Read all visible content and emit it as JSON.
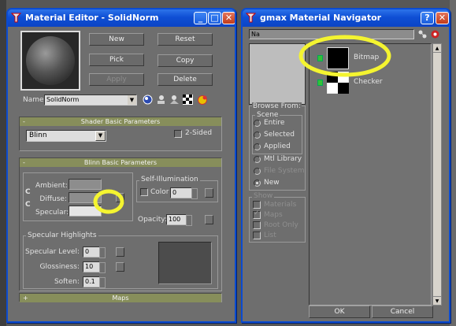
{
  "material_editor": {
    "title": "Material Editor - SolidNorm",
    "buttons": {
      "new": "New",
      "reset": "Reset",
      "pick": "Pick",
      "copy": "Copy",
      "apply": "Apply",
      "delete": "Delete"
    },
    "name_label": "Name",
    "name_value": "SolidNorm",
    "shader_rollout": {
      "title": "Shader Basic Parameters",
      "shader_value": "Blinn",
      "two_sided_label": "2-Sided"
    },
    "blinn_rollout": {
      "title": "Blinn Basic Parameters",
      "ambient_label": "Ambient:",
      "diffuse_label": "Diffuse:",
      "specular_label": "Specular:",
      "lock_c1": "C",
      "lock_c2": "C",
      "self_illum_title": "Self-Illumination",
      "color_label": "Color",
      "color_value": "0",
      "opacity_label": "Opacity:",
      "opacity_value": "100",
      "specular_group_title": "Specular Highlights",
      "spec_level_label": "Specular Level:",
      "spec_level_value": "0",
      "glossiness_label": "Glossiness:",
      "glossiness_value": "10",
      "soften_label": "Soften:",
      "soften_value": "0.1"
    },
    "maps_rollout": {
      "title": "Maps",
      "toggle": "+"
    },
    "collapse_symbol": "-"
  },
  "navigator": {
    "title": "gmax Material Navigator",
    "name_label": "Na",
    "items": [
      {
        "label": "Bitmap"
      },
      {
        "label": "Checker"
      }
    ],
    "browse_from_label": "Browse From:",
    "scene_group_label": "Scene",
    "scene_options": [
      {
        "label": "Entire",
        "enabled": true
      },
      {
        "label": "Selected",
        "enabled": true
      },
      {
        "label": "Applied",
        "enabled": true
      }
    ],
    "other_options": [
      {
        "label": "Mtl Library",
        "enabled": true
      },
      {
        "label": "File System",
        "enabled": false
      },
      {
        "label": "New",
        "enabled": true,
        "selected": true
      }
    ],
    "show_label": "Show",
    "show_options": [
      {
        "label": "Materials",
        "checked": false
      },
      {
        "label": "Maps",
        "checked": true
      },
      {
        "label": "Root Only",
        "checked": false
      },
      {
        "label": "List",
        "checked": false
      }
    ],
    "ok_label": "OK",
    "cancel_label": "Cancel"
  },
  "window_buttons": {
    "minimize": "_",
    "maximize": "□",
    "close": "✕",
    "help": "?"
  },
  "colors": {
    "title_blue": "#0f4fd4",
    "panel_gray": "#6e6e6e",
    "rollout_header": "#878e5b",
    "highlight": "#f4f430"
  }
}
